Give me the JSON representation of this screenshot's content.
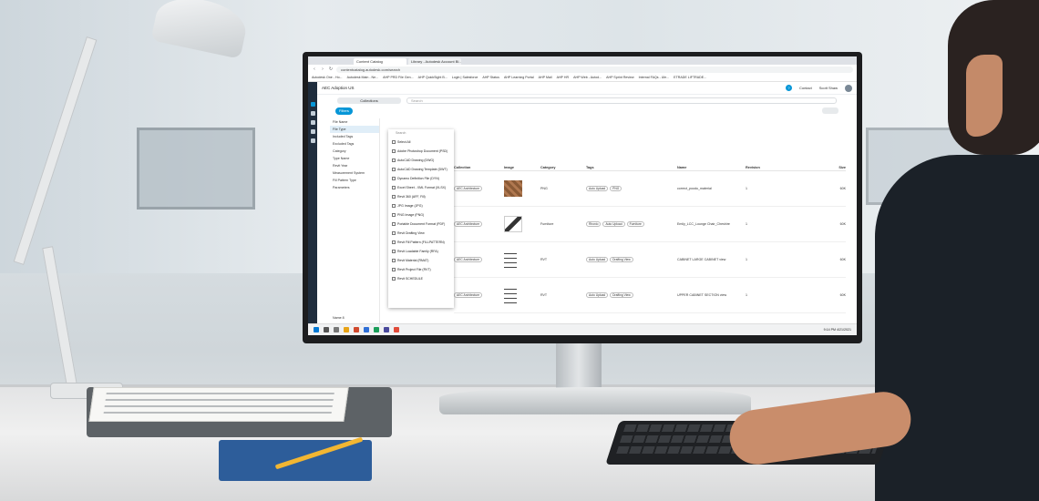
{
  "browser": {
    "tabs": [
      "Content Catalog",
      "Library - Autodesk Account BI..."
    ],
    "url": "contentcatalog.autodesk.com/search",
    "bookmarks": [
      "Autodesk One - Ho...",
      "Autodesk Main - Ne...",
      "AHP PRD File Gen...",
      "AHP QuickSight B...",
      "Login | Salesforce",
      "AHP Status",
      "AHP Learning Portal",
      "AHP Mail",
      "AHP HR",
      "AHP Web - Autod...",
      "AHP Sprint Review",
      "Internal FAQs - Ule...",
      "ETRADE LIFTRADE..."
    ]
  },
  "app": {
    "hub_name": "AEC Adoption US",
    "help_label": "?",
    "contact_label": "Contact",
    "user_name": "Scott Shaw",
    "collections_label": "Collections",
    "search_placeholder": "Search",
    "filter_button": "Filters"
  },
  "left_panel": {
    "items": [
      "File Name",
      "File Type",
      "Included Tags",
      "Excluded Tags",
      "Category",
      "Type Name",
      "Revit Year",
      "Measurement System",
      "Fill Pattern Type",
      "Parameters"
    ],
    "bottom_label": "Name",
    "bottom_value": "8"
  },
  "dropdown": {
    "search_placeholder": "Search",
    "items": [
      "Select All",
      "Adobe Photoshop Document (PSD)",
      "AutoCAD Drawing (DWG)",
      "AutoCAD Drawing Template (DWT)",
      "Dynamo Definition File (DYN)",
      "Excel Sheet - XML Format (XLSX)",
      "Revit 360 (AFF, Fill)",
      "JPG Image (JPG)",
      "PNG Image (PNG)",
      "Portable Document Format (PDF)",
      "Revit Drafting View",
      "Revit Fill Pattern (FILLPATTERN)",
      "Revit Loadable Family (RFA)",
      "Revit Material (RMAT)",
      "Revit Project File (RVT)",
      "Revit SCHEDULE"
    ]
  },
  "table": {
    "headers": [
      "Collection",
      "Image",
      "Category",
      "Tags",
      "Name",
      "Revision",
      "Size"
    ],
    "rows": [
      {
        "collection": "AEC Architecture",
        "category": "PNG",
        "tags": [
          "Auto Upload",
          "PNG"
        ],
        "name": "correct_poodu_material",
        "revision": "1",
        "size": "60K"
      },
      {
        "collection": "AEC Architecture",
        "category": "Furniture",
        "tags": [
          "Rhonio",
          "Auto Upload",
          "Furniture"
        ],
        "name": "Emily_LCC_Lounge Chair_Cheshire",
        "revision": "1",
        "size": "60K"
      },
      {
        "collection": "AEC Architecture",
        "category": "RVT",
        "tags": [
          "Auto Upload",
          "Drafting View"
        ],
        "name": "CABINET LARGE CABINET view",
        "revision": "1",
        "size": "60K"
      },
      {
        "collection": "AEC Architecture",
        "category": "RVT",
        "tags": [
          "Auto Upload",
          "Drafting View"
        ],
        "name": "UPPER CABINET SECTION view",
        "revision": "1",
        "size": "60K"
      }
    ]
  },
  "taskbar": {
    "time": "9:14 PM",
    "date": "4/21/2021"
  },
  "colors": {
    "accent": "#0696d7",
    "rail": "#1f2d3d"
  }
}
